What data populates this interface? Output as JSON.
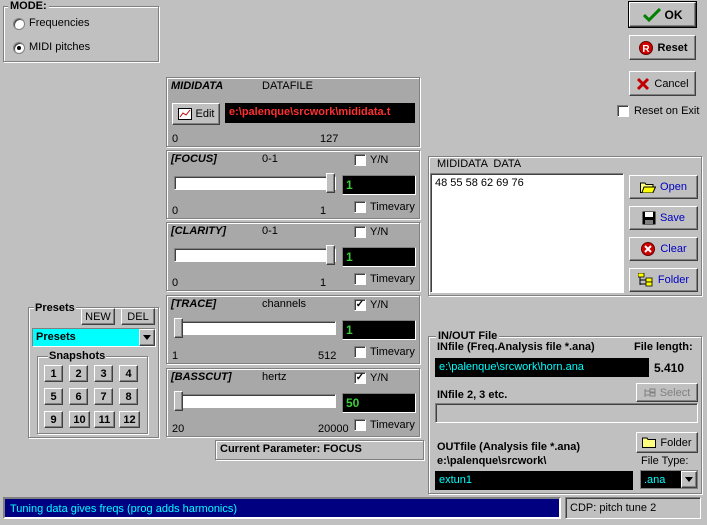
{
  "mode": {
    "title": "MODE:",
    "options": [
      "Frequencies",
      "MIDI pitches"
    ],
    "selected": "MIDI pitches"
  },
  "actions": {
    "ok": "OK",
    "reset": "Reset",
    "cancel": "Cancel",
    "reset_on_exit": "Reset on Exit"
  },
  "mididata": {
    "label": "MIDIDATA",
    "type": "DATAFILE",
    "edit_label": "Edit",
    "path": "e:\\palenque\\srcwork\\mididata.t",
    "min": "0",
    "max": "127"
  },
  "params": [
    {
      "name": "[FOCUS]",
      "range_label": "0-1",
      "yn_label": "Y/N",
      "yn": false,
      "value": "1",
      "timevary_label": "Timevary",
      "min": "0",
      "max": "1",
      "level": 1.0
    },
    {
      "name": "[CLARITY]",
      "range_label": "0-1",
      "yn_label": "Y/N",
      "yn": false,
      "value": "1",
      "timevary_label": "Timevary",
      "min": "0",
      "max": "1",
      "level": 1.0
    },
    {
      "name": "[TRACE]",
      "range_label": "channels",
      "yn_label": "Y/N",
      "yn": true,
      "value": "1",
      "timevary_label": "Timevary",
      "min": "1",
      "max": "512",
      "level": 0.0
    },
    {
      "name": "[BASSCUT]",
      "range_label": "hertz",
      "yn_label": "Y/N",
      "yn": true,
      "value": "50",
      "timevary_label": "Timevary",
      "min": "20",
      "max": "20000",
      "level": 0.0
    }
  ],
  "current_parameter": "Current Parameter: FOCUS",
  "mididata_panel": {
    "title": "MIDIDATA  DATA",
    "content": "48 55 58 62 69 76",
    "buttons": [
      "Open",
      "Save",
      "Clear",
      "Folder"
    ]
  },
  "presets": {
    "title": "Presets",
    "new_label": "NEW",
    "del_label": "DEL",
    "selected": "Presets",
    "snapshots_title": "Snapshots",
    "snapshots": [
      "1",
      "2",
      "3",
      "4",
      "5",
      "6",
      "7",
      "8",
      "9",
      "10",
      "11",
      "12"
    ]
  },
  "inout": {
    "title": "IN/OUT File",
    "infile_label": "INfile (Freq.Analysis file *.ana)",
    "file_length_label": "File length:",
    "infile_path": "e:\\palenque\\srcwork\\horn.ana",
    "file_length": "5.410",
    "infile2_label": "INfile 2, 3 etc.",
    "select_label": "Select",
    "outfile_label": "OUTfile (Analysis file *.ana)",
    "outfile_dir": "e:\\palenque\\srcwork\\",
    "folder_label": "Folder",
    "filetype_label": "File Type:",
    "outfile_name": "extun1",
    "filetype": ".ana"
  },
  "status": {
    "message": "Tuning data gives freqs (prog adds harmonics)",
    "program": "CDP: pitch tune 2"
  }
}
